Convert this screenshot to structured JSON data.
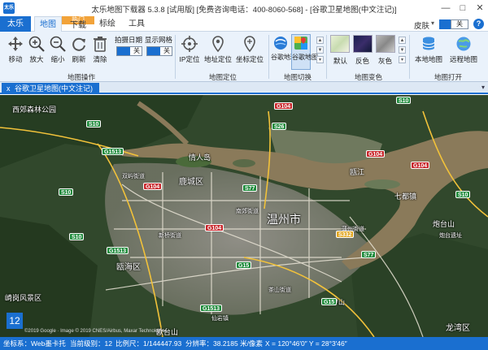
{
  "window": {
    "title": "太乐地图下载器 5.3.8 [试用版] [免费咨询电话：400-8060-568] - [谷歌卫星地图(中文注记)]",
    "logo_text": "太乐",
    "controls": {
      "minimize": "—",
      "maximize": "□",
      "close": "✕"
    }
  },
  "ribbon_tabs": {
    "file": "太乐",
    "tabs": [
      {
        "label": "地图",
        "active": true
      },
      {
        "label": "下载",
        "active": false
      },
      {
        "label": "标绘",
        "active": false
      },
      {
        "label": "工具",
        "active": false
      }
    ],
    "hot_badge": "热门",
    "skin_label": "皮肤",
    "skin_arrow": "▾",
    "skin_toggle": "关",
    "help": "?"
  },
  "ribbon": {
    "map_ops": {
      "label": "地图操作",
      "buttons": [
        {
          "label": "移动",
          "icon": "move-icon"
        },
        {
          "label": "放大",
          "icon": "zoom-in-icon"
        },
        {
          "label": "缩小",
          "icon": "zoom-out-icon"
        },
        {
          "label": "刷新",
          "icon": "refresh-icon"
        },
        {
          "label": "清除",
          "icon": "trash-icon"
        }
      ],
      "shoot_date": {
        "label": "拍摄日期",
        "state": "关"
      },
      "show_grid": {
        "label": "显示网格",
        "state": "关"
      }
    },
    "map_locate": {
      "label": "地图定位",
      "buttons": [
        {
          "label": "IP定位",
          "icon": "crosshair-icon"
        },
        {
          "label": "地址定位",
          "icon": "pin-icon"
        },
        {
          "label": "坐标定位",
          "icon": "pin-coord-icon"
        }
      ]
    },
    "map_switch": {
      "label": "地图切换",
      "buttons": [
        {
          "label": "谷歌地球",
          "icon": "earth-icon"
        },
        {
          "label": "谷歌地图",
          "icon": "google-maps-icon"
        }
      ]
    },
    "map_style": {
      "label": "地图变色",
      "buttons": [
        {
          "label": "默认"
        },
        {
          "label": "反色"
        },
        {
          "label": "灰色"
        }
      ]
    },
    "map_open": {
      "label": "地图打开",
      "buttons": [
        {
          "label": "本地地图",
          "icon": "database-icon"
        },
        {
          "label": "远程地图",
          "icon": "globe-icon"
        }
      ]
    }
  },
  "doc_tab": {
    "close": "x",
    "label": "谷歌卫星地图(中文注记)",
    "arrow": "▾"
  },
  "map": {
    "zoom_badge": "12",
    "attribution": "©2019 Google · Image © 2019 CNES/Airbus, Maxar Technologies",
    "places": [
      {
        "text": "西郊森林公园"
      },
      {
        "text": "鹿城区"
      },
      {
        "text": "温州市"
      },
      {
        "text": "瓯海区"
      },
      {
        "text": "龙湾区"
      },
      {
        "text": "情人岛"
      },
      {
        "text": "瓯江"
      },
      {
        "text": "崎岗风景区"
      },
      {
        "text": "炮台山"
      },
      {
        "text": "七都镇"
      },
      {
        "text": "新桥街道"
      },
      {
        "text": "双屿街道"
      },
      {
        "text": "南郊街道"
      },
      {
        "text": "蒲州街道"
      },
      {
        "text": "炮台遗址"
      },
      {
        "text": "大罗山"
      },
      {
        "text": "茶山街道"
      },
      {
        "text": "仙岩镇"
      },
      {
        "text": "欧台山"
      }
    ],
    "shields": [
      {
        "text": "G104",
        "color": "red"
      },
      {
        "text": "S10",
        "color": "green"
      },
      {
        "text": "S10",
        "color": "green"
      },
      {
        "text": "S26",
        "color": "green"
      },
      {
        "text": "G1513",
        "color": "green"
      },
      {
        "text": "S77",
        "color": "green"
      },
      {
        "text": "G104",
        "color": "red"
      },
      {
        "text": "G104",
        "color": "red"
      },
      {
        "text": "S332",
        "color": "yellow"
      },
      {
        "text": "S77",
        "color": "green"
      },
      {
        "text": "G15",
        "color": "green"
      },
      {
        "text": "G1513",
        "color": "green"
      },
      {
        "text": "S10",
        "color": "green"
      },
      {
        "text": "G15",
        "color": "green"
      },
      {
        "text": "G104",
        "color": "red"
      },
      {
        "text": "S10",
        "color": "green"
      },
      {
        "text": "G1513",
        "color": "green"
      },
      {
        "text": "G104",
        "color": "red"
      },
      {
        "text": "S10",
        "color": "green"
      }
    ]
  },
  "status": {
    "crs": "坐标系：Web墨卡托",
    "level": "当前级别：12",
    "scale": "比例尺：1/144447.93",
    "resolution": "分辨率：38.2185 米/像素",
    "coords": "X = 120°46′0″   Y = 28°3′46″"
  }
}
